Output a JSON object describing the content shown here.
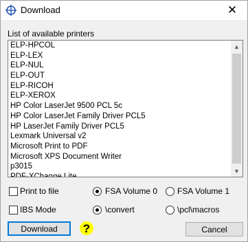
{
  "window": {
    "title": "Download",
    "close_glyph": "✕"
  },
  "printers": {
    "label": "List of available printers",
    "items": [
      "ELP-HPCOL",
      "ELP-LEX",
      "ELP-NUL",
      "ELP-OUT",
      "ELP-RICOH",
      "ELP-XEROX",
      "HP Color LaserJet 9500 PCL 5c",
      "HP Color LaserJet Family Driver PCL5",
      "HP LaserJet Family Driver PCL5",
      "Lexmark Universal v2",
      "Microsoft Print to PDF",
      "Microsoft XPS Document Writer",
      "p3015",
      "PDF-XChange Lite"
    ]
  },
  "options": {
    "print_to_file": "Print to file",
    "ibs_mode": "IBS Mode",
    "volume0": "FSA Volume 0",
    "volume1": "FSA Volume 1",
    "convert": "\\convert",
    "pcl_macros": "\\pcl\\macros"
  },
  "buttons": {
    "download": "Download",
    "cancel": "Cancel",
    "help": "?"
  }
}
